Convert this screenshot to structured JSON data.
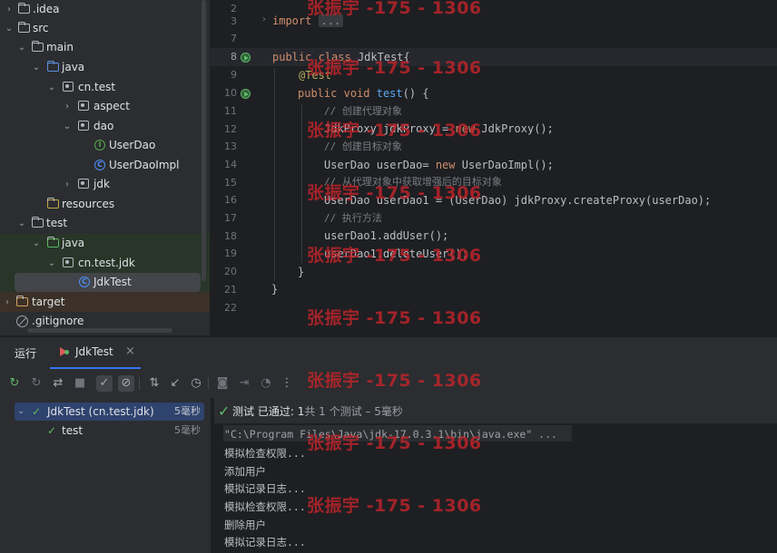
{
  "tree": {
    "items": [
      {
        "label": ".idea",
        "icon": "folder-icon"
      },
      {
        "label": "src",
        "icon": "folder-icon"
      },
      {
        "label": "main",
        "icon": "folder-icon"
      },
      {
        "label": "java",
        "icon": "source-folder-icon"
      },
      {
        "label": "cn.test",
        "icon": "package-icon"
      },
      {
        "label": "aspect",
        "icon": "package-icon"
      },
      {
        "label": "dao",
        "icon": "package-icon"
      },
      {
        "label": "UserDao",
        "icon": "interface-icon"
      },
      {
        "label": "UserDaoImpl",
        "icon": "class-icon"
      },
      {
        "label": "jdk",
        "icon": "package-icon"
      },
      {
        "label": "resources",
        "icon": "resources-folder-icon"
      },
      {
        "label": "test",
        "icon": "folder-icon"
      },
      {
        "label": "java",
        "icon": "test-source-folder-icon"
      },
      {
        "label": "cn.test.jdk",
        "icon": "package-icon"
      },
      {
        "label": "JdkTest",
        "icon": "class-icon"
      },
      {
        "label": "target",
        "icon": "folder-icon"
      },
      {
        "label": ".gitignore",
        "icon": "ignore-file-icon"
      }
    ]
  },
  "editor": {
    "lines": [
      {
        "no": "2",
        "text": ""
      },
      {
        "no": "3",
        "text": "import ..."
      },
      {
        "no": "7",
        "text": ""
      },
      {
        "no": "8",
        "text": "public class JdkTest{"
      },
      {
        "no": "9",
        "text": "@Test"
      },
      {
        "no": "10",
        "text": "public void test() {"
      },
      {
        "no": "11",
        "text": "// 创建代理对象"
      },
      {
        "no": "12",
        "text": "JdkProxy jdkProxy = new JdkProxy();"
      },
      {
        "no": "13",
        "text": "// 创建目标对象"
      },
      {
        "no": "14",
        "text": "UserDao userDao= new UserDaoImpl();"
      },
      {
        "no": "15",
        "text": "// 从代理对象中获取增强后的目标对象"
      },
      {
        "no": "16",
        "text": "UserDao userDao1 = (UserDao) jdkProxy.createProxy(userDao);"
      },
      {
        "no": "17",
        "text": "// 执行方法"
      },
      {
        "no": "18",
        "text": "userDao1.addUser();"
      },
      {
        "no": "19",
        "text": "userDao1.deleteUser();"
      },
      {
        "no": "20",
        "text": "}"
      },
      {
        "no": "21",
        "text": "}"
      },
      {
        "no": "22",
        "text": ""
      }
    ]
  },
  "code": {
    "import_kw": "import",
    "import_fold": "...",
    "public": "public",
    "class": "class",
    "class_name": "JdkTest{",
    "annotation": "@Test",
    "void": "void",
    "method": "test",
    "method_tail": "() {",
    "c1": "// 创建代理对象",
    "l12a": "JdkProxy jdkProxy = ",
    "new": "new",
    "l12b": " JdkProxy();",
    "c2": "// 创建目标对象",
    "l14a": "UserDao userDao= ",
    "l14b": " UserDaoImpl();",
    "c3": "// 从代理对象中获取增强后的目标对象",
    "l16": "UserDao userDao1 = (UserDao) jdkProxy.createProxy(userDao);",
    "c4": "// 执行方法",
    "l18": "userDao1.addUser();",
    "l19": "userDao1.deleteUser();",
    "close_inner": "}",
    "close_outer": "}"
  },
  "watermark": "张振宇 -175 - 1306",
  "run_window": {
    "tab_run": "运行",
    "tab_config": "JdkTest",
    "tab_close": "×",
    "toolbar_icons": [
      "rerun-icon",
      "rerun-failed-icon",
      "toggle-auto-test-icon",
      "stop-icon",
      "show-passed-icon",
      "show-ignored-icon",
      "sort-icon",
      "import-tests-icon",
      "history-icon",
      "screenshot-icon",
      "export-icon",
      "coverage-icon",
      "more-icon"
    ],
    "tests": [
      {
        "label": "JdkTest (cn.test.jdk)",
        "time": "5毫秒"
      },
      {
        "label": "test",
        "time": "5毫秒"
      }
    ],
    "status_prefix": "测试 已通过: ",
    "status_count": "1",
    "status_suffix": "共 1 个测试 – 5毫秒",
    "console": [
      "\"C:\\Program Files\\Java\\jdk-17.0.3.1\\bin\\java.exe\" ...",
      "模拟检查权限...",
      "添加用户",
      "模拟记录日志...",
      "模拟检查权限...",
      "删除用户",
      "模拟记录日志..."
    ]
  },
  "colors": {
    "keyword": "#cf8e6d",
    "function": "#56a8f5",
    "comment": "#7a7e85",
    "annotation": "#b3ae60",
    "success": "#5fb865",
    "watermark": "#c0252b",
    "accent": "#3574f0"
  }
}
